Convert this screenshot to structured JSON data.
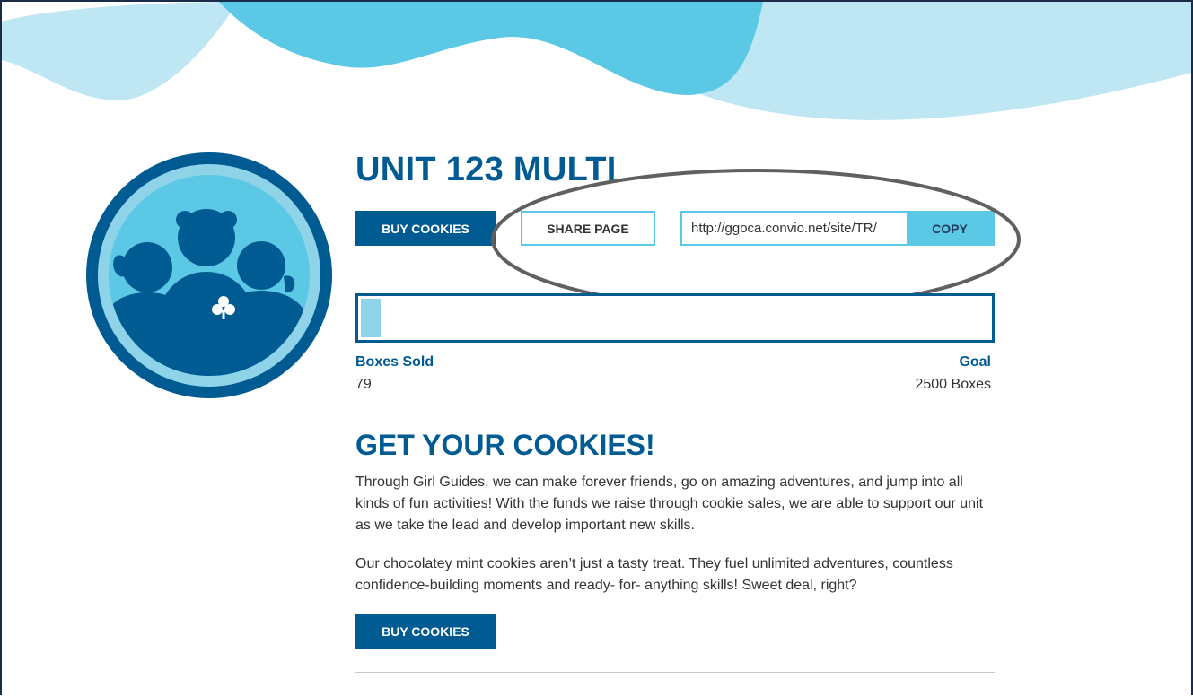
{
  "page": {
    "title": "UNIT 123 MULTI",
    "buy_label": "BUY COOKIES",
    "share_label": "SHARE PAGE",
    "copy_label": "COPY",
    "share_url": "http://ggoca.convio.net/site/TR/"
  },
  "progress": {
    "sold_label": "Boxes Sold",
    "sold_value": "79",
    "goal_label": "Goal",
    "goal_value": "2500 Boxes",
    "fraction": 0.0316
  },
  "content": {
    "heading": "GET YOUR COOKIES!",
    "paragraph1": "Through Girl Guides, we can make forever friends, go on amazing adventures, and jump into all kinds of fun activities! With the funds we raise through cookie sales, we are able to support our unit as we take the lead and develop important new skills.",
    "paragraph2": "Our chocolatey mint cookies aren’t just a tasty treat. They fuel unlimited adventures, countless confidence-building moments and ready- for- anything skills! Sweet deal, right?"
  },
  "colors": {
    "brand_blue": "#005b93",
    "light_blue": "#5bc9e6",
    "pale_blue": "#bfe6f3",
    "progress_fill": "#8fd3e9",
    "annotation": "#606060"
  },
  "icons": {
    "avatar": "girl-guides-group-avatar",
    "trefoil": "trefoil-icon"
  }
}
